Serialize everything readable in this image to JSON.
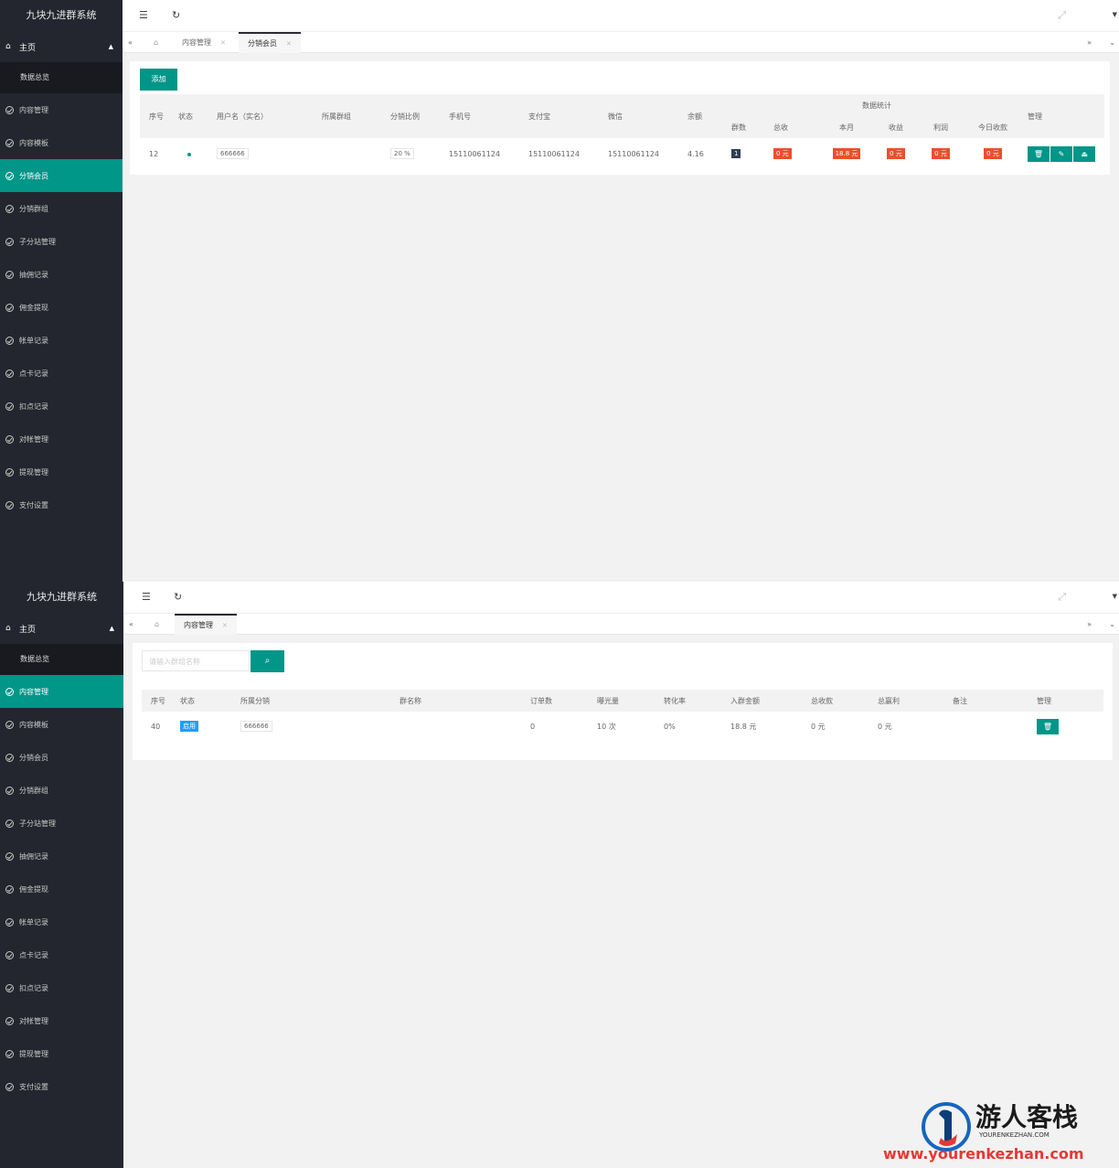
{
  "app_title": "九块九进群系统",
  "sidebar_home": "主页",
  "sidebar_sub": "数据总览",
  "sidebar_items": [
    "内容管理",
    "内容模板",
    "分销会员",
    "分销群组",
    "子分站管理",
    "抽佣记录",
    "佣金提现",
    "帐单记录",
    "点卡记录",
    "扣点记录",
    "对帐管理",
    "提现管理",
    "支付设置"
  ],
  "panel1": {
    "active_item": "分销会员",
    "tabs": [
      {
        "label": "内容管理"
      },
      {
        "label": "分销会员"
      }
    ],
    "add_label": "添加",
    "header_group": "数据统计",
    "columns": [
      "序号",
      "状态",
      "用户名（实名）",
      "所属群组",
      "分销比例",
      "手机号",
      "支付宝",
      "微信",
      "余额",
      "群数",
      "总收",
      "本月",
      "收益",
      "利润",
      "今日收款",
      "管理"
    ],
    "row": {
      "id": "12",
      "username": "666666",
      "ratio": "20 %",
      "phone": "15110061124",
      "alipay": "15110061124",
      "wechat": "15110061124",
      "balance": "4.16",
      "groups": "1",
      "total": "0 元",
      "month": "18.8 元",
      "income": "0 元",
      "profit": "0 元",
      "today": "0 元"
    }
  },
  "panel2": {
    "active_item": "内容管理",
    "tabs": [
      {
        "label": "内容管理"
      }
    ],
    "search_placeholder": "请输入群组名称",
    "columns": [
      "序号",
      "状态",
      "所属分销",
      "群名称",
      "订单数",
      "曝光量",
      "转化率",
      "入群金额",
      "总收款",
      "总赢利",
      "备注",
      "管理"
    ],
    "row": {
      "id": "40",
      "status": "启用",
      "distributor": "666666",
      "orders": "0",
      "views": "10 次",
      "conversion": "0%",
      "amount": "18.8 元",
      "total_received": "0 元",
      "total_profit": "0 元"
    }
  },
  "watermark": {
    "brand": "游人客栈",
    "sub": "YOURENKEZHAN.COM",
    "url": "www.yourenkezhan.com"
  },
  "colors": {
    "accent": "#009688",
    "sidebar": "#23262e",
    "badge_red": "#e8502e",
    "badge_blue": "#1e9fff"
  }
}
